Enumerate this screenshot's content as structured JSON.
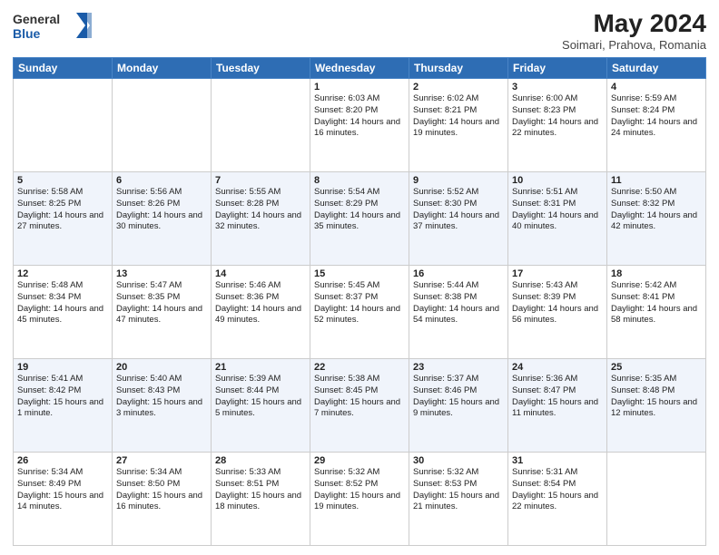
{
  "header": {
    "logo_line1": "General",
    "logo_line2": "Blue",
    "title": "May 2024",
    "subtitle": "Soimari, Prahova, Romania"
  },
  "days_of_week": [
    "Sunday",
    "Monday",
    "Tuesday",
    "Wednesday",
    "Thursday",
    "Friday",
    "Saturday"
  ],
  "weeks": [
    [
      {
        "num": "",
        "info": ""
      },
      {
        "num": "",
        "info": ""
      },
      {
        "num": "",
        "info": ""
      },
      {
        "num": "1",
        "info": "Sunrise: 6:03 AM\nSunset: 8:20 PM\nDaylight: 14 hours\nand 16 minutes."
      },
      {
        "num": "2",
        "info": "Sunrise: 6:02 AM\nSunset: 8:21 PM\nDaylight: 14 hours\nand 19 minutes."
      },
      {
        "num": "3",
        "info": "Sunrise: 6:00 AM\nSunset: 8:23 PM\nDaylight: 14 hours\nand 22 minutes."
      },
      {
        "num": "4",
        "info": "Sunrise: 5:59 AM\nSunset: 8:24 PM\nDaylight: 14 hours\nand 24 minutes."
      }
    ],
    [
      {
        "num": "5",
        "info": "Sunrise: 5:58 AM\nSunset: 8:25 PM\nDaylight: 14 hours\nand 27 minutes."
      },
      {
        "num": "6",
        "info": "Sunrise: 5:56 AM\nSunset: 8:26 PM\nDaylight: 14 hours\nand 30 minutes."
      },
      {
        "num": "7",
        "info": "Sunrise: 5:55 AM\nSunset: 8:28 PM\nDaylight: 14 hours\nand 32 minutes."
      },
      {
        "num": "8",
        "info": "Sunrise: 5:54 AM\nSunset: 8:29 PM\nDaylight: 14 hours\nand 35 minutes."
      },
      {
        "num": "9",
        "info": "Sunrise: 5:52 AM\nSunset: 8:30 PM\nDaylight: 14 hours\nand 37 minutes."
      },
      {
        "num": "10",
        "info": "Sunrise: 5:51 AM\nSunset: 8:31 PM\nDaylight: 14 hours\nand 40 minutes."
      },
      {
        "num": "11",
        "info": "Sunrise: 5:50 AM\nSunset: 8:32 PM\nDaylight: 14 hours\nand 42 minutes."
      }
    ],
    [
      {
        "num": "12",
        "info": "Sunrise: 5:48 AM\nSunset: 8:34 PM\nDaylight: 14 hours\nand 45 minutes."
      },
      {
        "num": "13",
        "info": "Sunrise: 5:47 AM\nSunset: 8:35 PM\nDaylight: 14 hours\nand 47 minutes."
      },
      {
        "num": "14",
        "info": "Sunrise: 5:46 AM\nSunset: 8:36 PM\nDaylight: 14 hours\nand 49 minutes."
      },
      {
        "num": "15",
        "info": "Sunrise: 5:45 AM\nSunset: 8:37 PM\nDaylight: 14 hours\nand 52 minutes."
      },
      {
        "num": "16",
        "info": "Sunrise: 5:44 AM\nSunset: 8:38 PM\nDaylight: 14 hours\nand 54 minutes."
      },
      {
        "num": "17",
        "info": "Sunrise: 5:43 AM\nSunset: 8:39 PM\nDaylight: 14 hours\nand 56 minutes."
      },
      {
        "num": "18",
        "info": "Sunrise: 5:42 AM\nSunset: 8:41 PM\nDaylight: 14 hours\nand 58 minutes."
      }
    ],
    [
      {
        "num": "19",
        "info": "Sunrise: 5:41 AM\nSunset: 8:42 PM\nDaylight: 15 hours\nand 1 minute."
      },
      {
        "num": "20",
        "info": "Sunrise: 5:40 AM\nSunset: 8:43 PM\nDaylight: 15 hours\nand 3 minutes."
      },
      {
        "num": "21",
        "info": "Sunrise: 5:39 AM\nSunset: 8:44 PM\nDaylight: 15 hours\nand 5 minutes."
      },
      {
        "num": "22",
        "info": "Sunrise: 5:38 AM\nSunset: 8:45 PM\nDaylight: 15 hours\nand 7 minutes."
      },
      {
        "num": "23",
        "info": "Sunrise: 5:37 AM\nSunset: 8:46 PM\nDaylight: 15 hours\nand 9 minutes."
      },
      {
        "num": "24",
        "info": "Sunrise: 5:36 AM\nSunset: 8:47 PM\nDaylight: 15 hours\nand 11 minutes."
      },
      {
        "num": "25",
        "info": "Sunrise: 5:35 AM\nSunset: 8:48 PM\nDaylight: 15 hours\nand 12 minutes."
      }
    ],
    [
      {
        "num": "26",
        "info": "Sunrise: 5:34 AM\nSunset: 8:49 PM\nDaylight: 15 hours\nand 14 minutes."
      },
      {
        "num": "27",
        "info": "Sunrise: 5:34 AM\nSunset: 8:50 PM\nDaylight: 15 hours\nand 16 minutes."
      },
      {
        "num": "28",
        "info": "Sunrise: 5:33 AM\nSunset: 8:51 PM\nDaylight: 15 hours\nand 18 minutes."
      },
      {
        "num": "29",
        "info": "Sunrise: 5:32 AM\nSunset: 8:52 PM\nDaylight: 15 hours\nand 19 minutes."
      },
      {
        "num": "30",
        "info": "Sunrise: 5:32 AM\nSunset: 8:53 PM\nDaylight: 15 hours\nand 21 minutes."
      },
      {
        "num": "31",
        "info": "Sunrise: 5:31 AM\nSunset: 8:54 PM\nDaylight: 15 hours\nand 22 minutes."
      },
      {
        "num": "",
        "info": ""
      }
    ]
  ]
}
